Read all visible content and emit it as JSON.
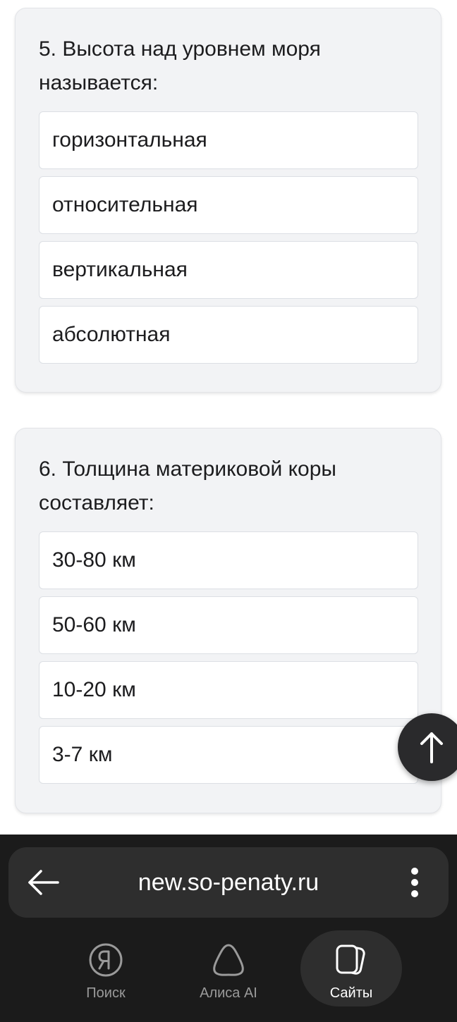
{
  "questions": [
    {
      "text": "5. Высота над уровнем моря называется:",
      "options": [
        "горизонтальная",
        "относительная",
        "вертикальная",
        "абсолютная"
      ]
    },
    {
      "text": "6. Толщина материковой коры составляет:",
      "options": [
        "30-80 км",
        "50-60 км",
        "10-20 км",
        "3-7 км"
      ]
    }
  ],
  "browser": {
    "url": "new.so-penaty.ru",
    "nav": {
      "search_label": "Поиск",
      "alice_label": "Алиса AI",
      "sites_label": "Сайты"
    }
  },
  "colors": {
    "card_background": "#f2f3f5",
    "browser_bar": "#1b1b1b",
    "url_pill": "#2e2e2e"
  },
  "icons": {
    "scroll_top": "arrow-up-icon",
    "back": "arrow-left-icon",
    "menu": "kebab-menu-icon",
    "search": "yandex-logo-icon",
    "alice": "alice-icon",
    "sites": "tabs-icon"
  }
}
